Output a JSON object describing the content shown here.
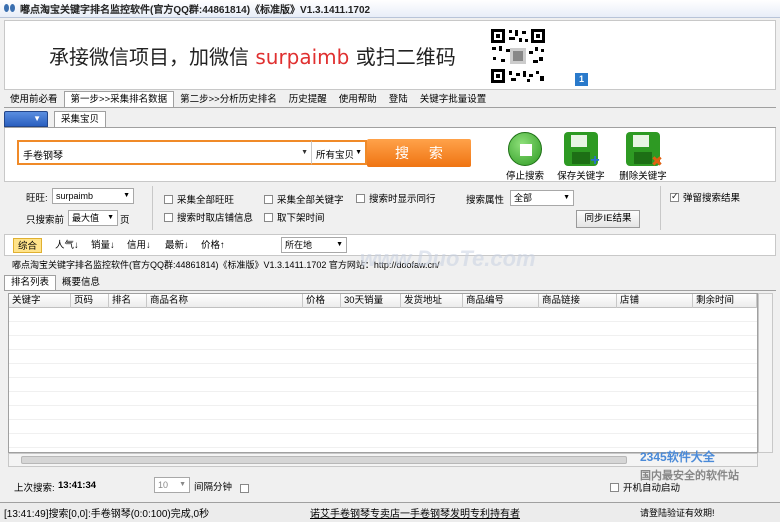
{
  "window": {
    "title": "嘟点淘宝关键字排名监控软件(官方QQ群:44861814)《标准版》V1.3.1411.1702"
  },
  "banner": {
    "text_prefix": "承接微信项目，加微信",
    "text_highlight": "surpaimb",
    "text_suffix": "或扫二维码",
    "badge": "1"
  },
  "menu": {
    "items": [
      "使用前必看",
      "第一步>>采集排名数据",
      "第二步>>分析历史排名",
      "历史提醒",
      "使用帮助",
      "登陆",
      "关键字批量设置"
    ],
    "active_index": 1
  },
  "subtabs": {
    "dropdown_label": "▼",
    "tab": "采集宝贝"
  },
  "search": {
    "keyword": "手卷钢琴",
    "category": "所有宝贝",
    "search_button": "搜 索"
  },
  "actions": {
    "stop": "停止搜索",
    "save": "保存关键字",
    "delete": "删除关键字"
  },
  "options": {
    "wangwang_label": "旺旺:",
    "wangwang_value": "surpaimb",
    "only_search_label": "只搜索前",
    "only_search_value": "最大值",
    "page_unit": "页",
    "chk_collect_all_ww": "采集全部旺旺",
    "chk_collect_all_kw": "采集全部关键字",
    "chk_show_peers": "搜索时显示同行",
    "chk_fetch_shop": "搜索时取店铺信息",
    "chk_take_down_time": "取下架时间",
    "search_attr_label": "搜索属性",
    "search_attr_value": "全部",
    "sync_ie_button": "同步IE结果",
    "popup_results": "弹留搜索结果"
  },
  "sortbar": {
    "items": [
      "综合",
      "人气↓",
      "销量↓",
      "信用↓",
      "最新↓",
      "价格↑"
    ],
    "location": "所在地"
  },
  "infobar": {
    "text": "嘟点淘宝关键字排名监控软件(官方QQ群:44861814)《标准版》V1.3.1411.1702  官方网站：http://doofaw.cn/"
  },
  "watermark": "www.DuoTe.com",
  "result_tabs": [
    "排名列表",
    "概要信息"
  ],
  "table": {
    "columns": [
      "关键字",
      "页码",
      "排名",
      "商品名称",
      "价格",
      "30天销量",
      "发货地址",
      "商品编号",
      "商品链接",
      "店铺",
      "剩余时间"
    ],
    "rows": []
  },
  "bottom": {
    "last_search_label": "上次搜索:",
    "last_search_time": "13:41:34",
    "interval_value": "10",
    "interval_label": "间隔分钟",
    "autostart_label": "开机自动启动"
  },
  "statusbar": {
    "log": "[13:41:49]搜索[0,0]:手卷钢琴(0:0:100)完成,0秒",
    "shop": "诺艾手卷钢琴专卖店一手卷钢琴发明专利持有者",
    "login_hint": "请登陆验证有效期!"
  },
  "overlay_logo": {
    "brand": "2345软件大全",
    "tagline": "国内最安全的软件站"
  }
}
